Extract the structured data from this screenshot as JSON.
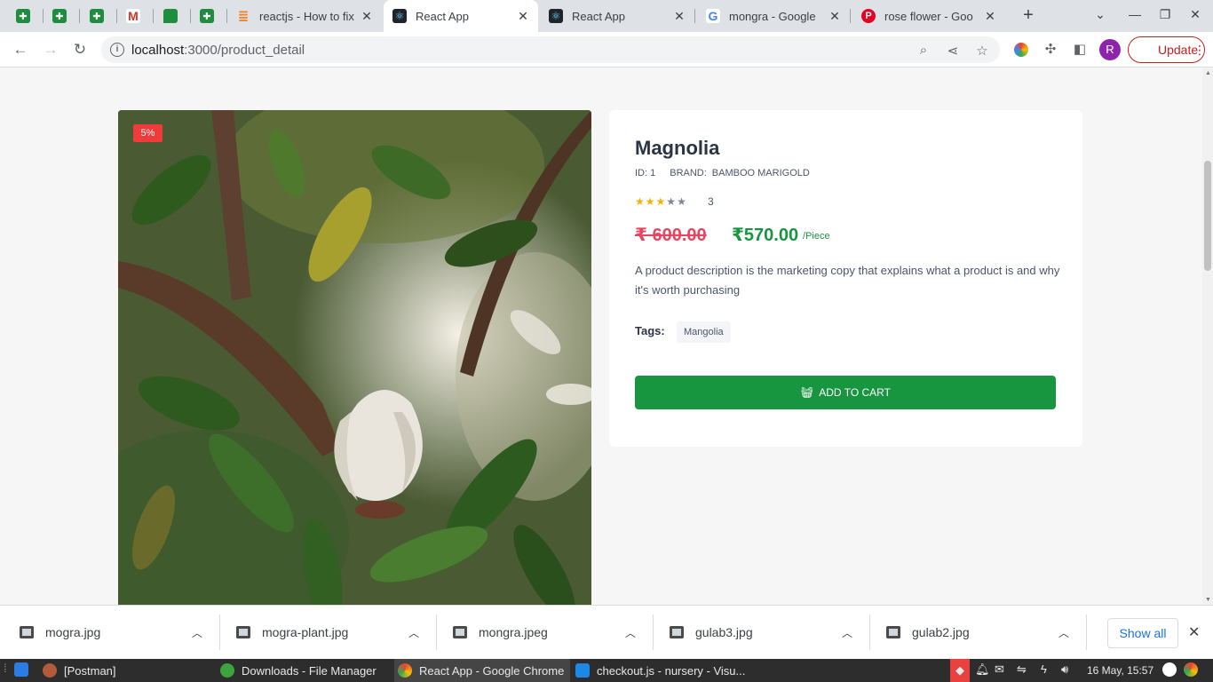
{
  "browser": {
    "tabs": [
      {
        "title": "",
        "icon": "sheets-icon"
      },
      {
        "title": "",
        "icon": "sheets-icon"
      },
      {
        "title": "",
        "icon": "sheets-icon"
      },
      {
        "title": "",
        "icon": "gmail-icon"
      },
      {
        "title": "",
        "icon": "chat-icon"
      },
      {
        "title": "",
        "icon": "sheets-icon"
      },
      {
        "title": "reactjs - How to fix",
        "icon": "stackoverflow-icon"
      },
      {
        "title": "React App",
        "icon": "react-icon",
        "active": true
      },
      {
        "title": "React App",
        "icon": "react-icon"
      },
      {
        "title": "mongra - Google S",
        "icon": "google-icon"
      },
      {
        "title": "rose flower - Goog",
        "icon": "pinterest-icon"
      }
    ],
    "url_host": "localhost",
    "url_path": ":3000/product_detail",
    "avatar_letter": "R",
    "update_label": "Update"
  },
  "product": {
    "discount_badge": "5%",
    "title": "Magnolia",
    "id_label": "ID: 1",
    "brand_label": "BRAND:",
    "brand_value": "BAMBOO MARIGOLD",
    "rating": 3,
    "rating_max": 5,
    "rating_count": "3",
    "old_price": "₹ 600.00",
    "new_price": "₹570.00",
    "unit": "/Piece",
    "description": "A product description is the marketing copy that explains what a product is and why it's worth purchasing",
    "tags_label": "Tags:",
    "tags": [
      "Mangolia"
    ],
    "add_to_cart_label": "ADD TO CART"
  },
  "downloads": {
    "items": [
      "mogra.jpg",
      "mogra-plant.jpg",
      "mongra.jpeg",
      "gulab3.jpg",
      "gulab2.jpg"
    ],
    "show_all_label": "Show all"
  },
  "taskbar": {
    "tasks": [
      "[Postman]",
      "Downloads - File Manager",
      "React App - Google Chrome",
      "checkout.js - nursery - Visu..."
    ],
    "clock": "16 May, 15:57"
  },
  "colors": {
    "accent_green": "#17953f",
    "old_price_red": "#e94560",
    "badge_red": "#ef3b3b",
    "star_gold": "#faaf00"
  }
}
